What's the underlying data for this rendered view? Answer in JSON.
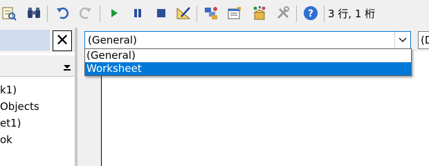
{
  "toolbar": {
    "icons": [
      "find-icon",
      "binoculars-icon",
      "undo-icon",
      "redo-icon",
      "run-icon",
      "break-icon",
      "reset-icon",
      "design-mode-icon",
      "project-explorer-icon",
      "properties-window-icon",
      "object-browser-icon",
      "toolbox-icon",
      "help-icon"
    ],
    "cursor_position": "3 行, 1 桁"
  },
  "project_pane": {
    "close_label": "✕",
    "tree_items": [
      "k1)",
      " Objects",
      "et1)",
      "ok"
    ]
  },
  "code_window": {
    "object_combo": {
      "value": "(General)",
      "options": [
        "(General)",
        "Worksheet"
      ],
      "selected_option": "Worksheet"
    },
    "procedure_combo": {
      "value": "(D"
    }
  },
  "colors": {
    "accent": "#0078d7",
    "toolbar_bg": "#f0f0f0",
    "selection_bg": "#0078d7"
  }
}
